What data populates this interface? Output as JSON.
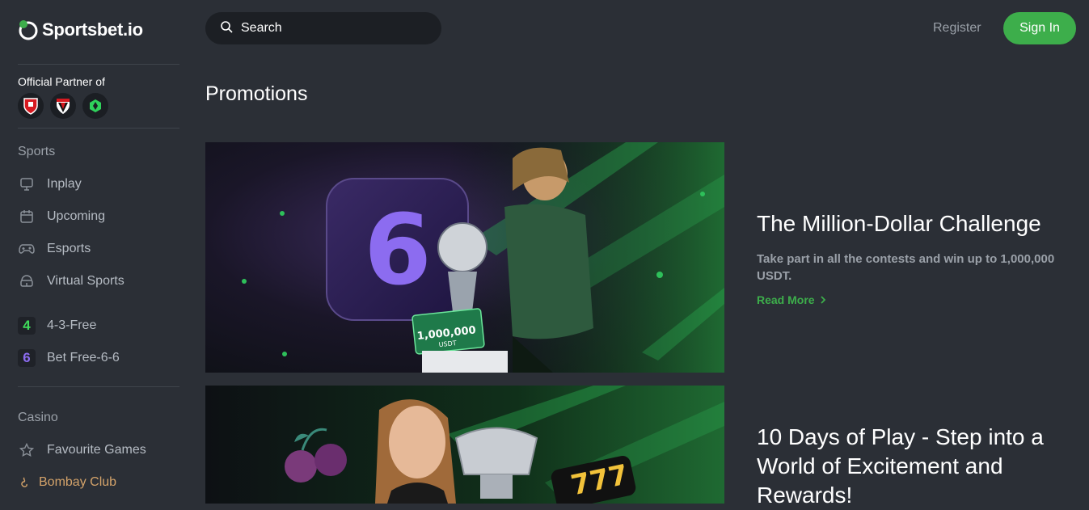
{
  "brand": {
    "name": "Sportsbet.io"
  },
  "partner": {
    "label": "Official Partner of"
  },
  "sidebar": {
    "sports_label": "Sports",
    "sports_items": [
      {
        "label": "Inplay",
        "icon": "monitor-icon"
      },
      {
        "label": "Upcoming",
        "icon": "calendar-icon"
      },
      {
        "label": "Esports",
        "icon": "gamepad-icon"
      },
      {
        "label": "Virtual Sports",
        "icon": "vr-headset-icon"
      }
    ],
    "promo_items": [
      {
        "label": "4-3-Free",
        "badge": "4",
        "color": "#3fdc5b"
      },
      {
        "label": "Bet Free-6-6",
        "badge": "6",
        "color": "#8c6cf0"
      }
    ],
    "casino_label": "Casino",
    "casino_items": [
      {
        "label": "Favourite Games",
        "icon": "star-icon"
      },
      {
        "label": "Bombay Club",
        "icon": "bombay-club-icon",
        "color": "#d4a36a"
      }
    ]
  },
  "header": {
    "search_placeholder": "Search",
    "register_label": "Register",
    "signin_label": "Sign In"
  },
  "main": {
    "title": "Promotions",
    "promotions": [
      {
        "title": "The Million-Dollar Challenge",
        "description": "Take part in all the contests and win up to 1,000,000 USDT.",
        "read_more": "Read More",
        "badge_number": "6",
        "prize_text": "1,000,000",
        "prize_unit": "USDT"
      },
      {
        "title": "10 Days of Play - Step into a World of Excitement and Rewards!",
        "slot_text": "777"
      }
    ]
  },
  "colors": {
    "accent": "#3dae4b",
    "background": "#2b2f36",
    "muted": "#9aa0a8",
    "bombay": "#d4a36a",
    "purple": "#8c6cf0"
  }
}
